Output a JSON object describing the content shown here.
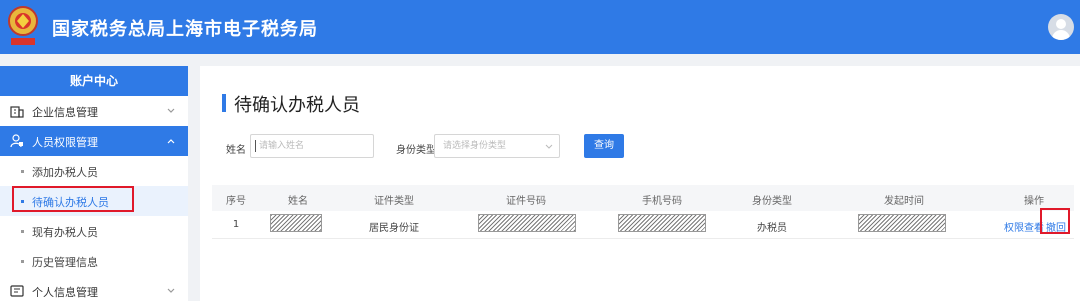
{
  "header": {
    "title": "国家税务总局上海市电子税务局",
    "logo_icon": "tax-emblem-icon",
    "avatar_icon": "user-avatar-icon"
  },
  "sidebar": {
    "title": "账户中心",
    "items": [
      {
        "label": "企业信息管理",
        "icon": "building-icon",
        "chevron": "chevron-down-icon"
      },
      {
        "label": "人员权限管理",
        "icon": "user-lock-icon",
        "chevron": "chevron-up-icon",
        "active": true
      },
      {
        "label": "个人信息管理",
        "icon": "id-card-icon",
        "chevron": "chevron-down-icon"
      }
    ],
    "subitems": [
      "添加办税人员",
      "待确认办税人员",
      "现有办税人员",
      "历史管理信息"
    ],
    "selected_subitem": "待确认办税人员"
  },
  "main": {
    "title": "待确认办税人员",
    "filters": {
      "name_label": "姓名",
      "name_placeholder": "请输入姓名",
      "type_label": "身份类型",
      "type_placeholder": "请选择身份类型",
      "query_button": "查询"
    },
    "table": {
      "columns": [
        "序号",
        "姓名",
        "证件类型",
        "证件号码",
        "手机号码",
        "身份类型",
        "发起时间",
        "操作"
      ],
      "rows": [
        {
          "index": "1",
          "name": "[redacted]",
          "id_type": "居民身份证",
          "id_number": "[redacted]",
          "phone": "[redacted]",
          "identity_type": "办税员",
          "start_time": "[redacted]",
          "actions": [
            "权限查看",
            "撤回"
          ]
        }
      ]
    }
  },
  "colors": {
    "brand_blue": "#2f7ae6",
    "highlight_red": "#e0192a"
  }
}
